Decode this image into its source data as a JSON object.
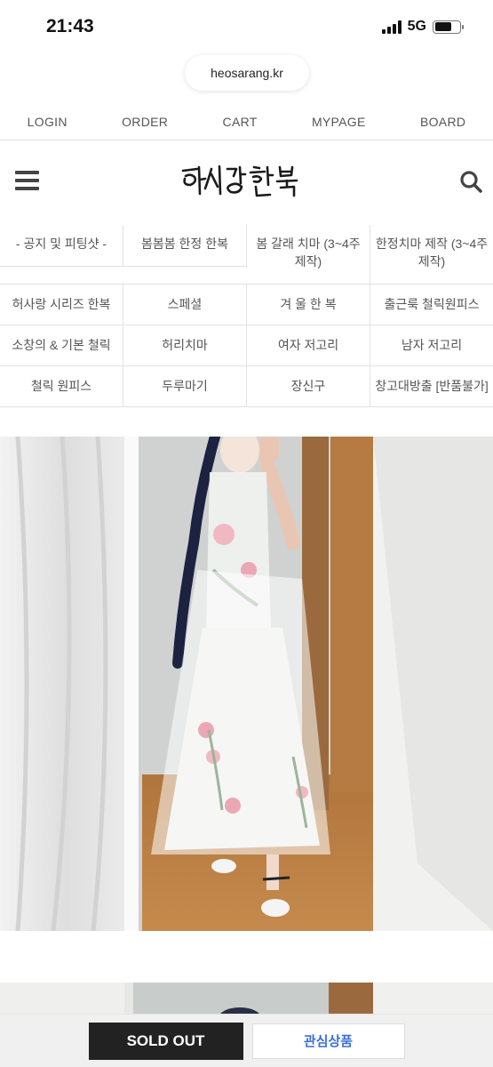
{
  "status_bar": {
    "time": "21:43",
    "network": "5G"
  },
  "browser": {
    "url": "heosarang.kr"
  },
  "top_nav": [
    {
      "label": "LOGIN"
    },
    {
      "label": "ORDER"
    },
    {
      "label": "CART"
    },
    {
      "label": "MYPAGE"
    },
    {
      "label": "BOARD"
    }
  ],
  "header": {
    "logo_text": "허사랑한복"
  },
  "categories": [
    [
      "- 공지 및 피팅샷 -",
      "봄봄봄 한정 한복",
      "봄 갈래 치마 (3~4주 제작)",
      "한정치마 제작 (3~4주 제작)"
    ],
    [
      "허사랑 시리즈 한복",
      "스페셜",
      "겨 울 한 복",
      "출근룩 철릭원피스"
    ],
    [
      "소창의 & 기본 철릭",
      "허리치마",
      "여자 저고리",
      "남자 저고리"
    ],
    [
      "철릭 원피스",
      "두루마기",
      "장신구",
      "창고대방출 [반품불가]"
    ]
  ],
  "bottom_bar": {
    "sold_out_label": "SOLD OUT",
    "wishlist_label": "관심상품"
  },
  "colors": {
    "accent": "#3a6fd8",
    "dark_button": "#222222"
  }
}
